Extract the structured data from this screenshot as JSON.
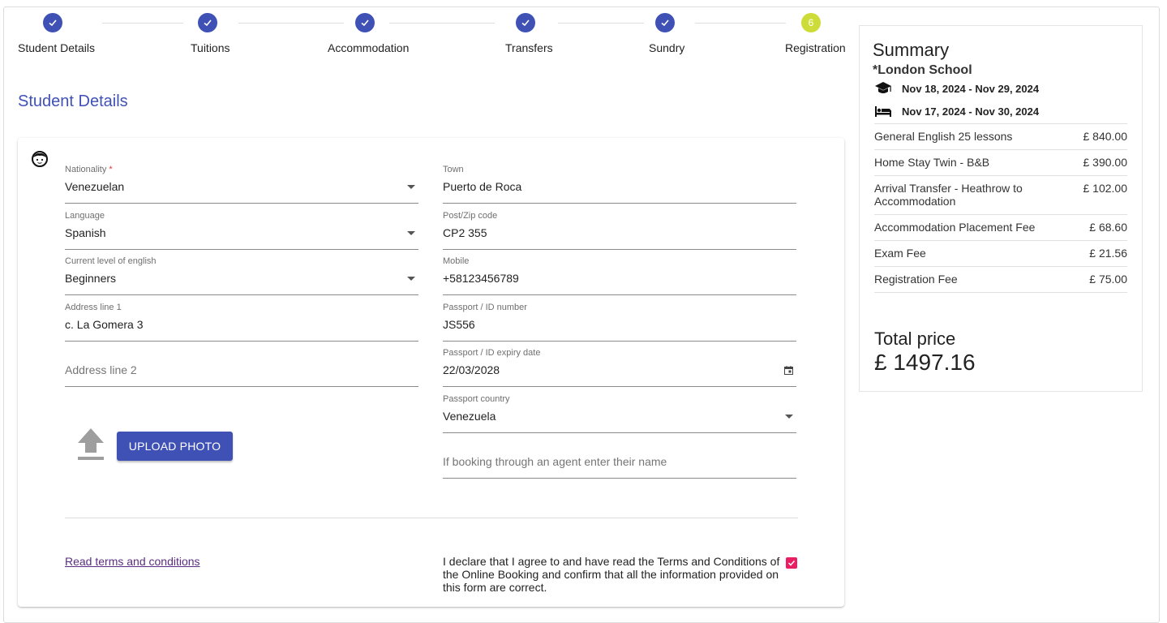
{
  "steps": [
    {
      "label": "Student Details",
      "status": "done"
    },
    {
      "label": "Tuitions",
      "status": "done"
    },
    {
      "label": "Accommodation",
      "status": "done"
    },
    {
      "label": "Transfers",
      "status": "done"
    },
    {
      "label": "Sundry",
      "status": "done"
    },
    {
      "label": "Registration",
      "status": "current",
      "number": "6"
    }
  ],
  "section_title": "Student Details",
  "form": {
    "nationality": {
      "label": "Nationality",
      "required_mark": "*",
      "value": "Venezuelan"
    },
    "language": {
      "label": "Language",
      "value": "Spanish"
    },
    "english_level": {
      "label": "Current level of english",
      "value": "Beginners"
    },
    "address1": {
      "label": "Address line 1",
      "value": "c. La Gomera 3"
    },
    "address2": {
      "placeholder": "Address line 2"
    },
    "town": {
      "label": "Town",
      "value": "Puerto de Roca"
    },
    "postcode": {
      "label": "Post/Zip code",
      "value": "CP2 355"
    },
    "mobile": {
      "label": "Mobile",
      "value": "+58123456789"
    },
    "passport_number": {
      "label": "Passport / ID number",
      "value": "JS556"
    },
    "passport_expiry": {
      "label": "Passport / ID expiry date",
      "value": "22/03/2028"
    },
    "passport_country": {
      "label": "Passport country",
      "value": "Venezuela"
    },
    "agent": {
      "placeholder": "If booking through an agent enter their name"
    },
    "upload_label": "UPLOAD PHOTO",
    "terms_link": "Read terms and conditions",
    "declaration": "I declare that I agree to and have read the Terms and Conditions of the Online Booking and confirm that all the information provided on this form are correct.",
    "declaration_checked": true
  },
  "summary": {
    "title": "Summary",
    "school": "*London School",
    "course_dates": "Nov 18, 2024 - Nov 29, 2024",
    "accommodation_dates": "Nov 17, 2024 - Nov 30, 2024",
    "items": [
      {
        "desc": "General English 25 lessons",
        "price": "£ 840.00"
      },
      {
        "desc": "Home Stay Twin - B&B",
        "price": "£ 390.00"
      },
      {
        "desc": "Arrival Transfer - Heathrow to Accommodation",
        "price": "£ 102.00"
      },
      {
        "desc": "Accommodation Placement Fee",
        "price": "£ 68.60"
      },
      {
        "desc": "Exam Fee",
        "price": "£ 21.56"
      },
      {
        "desc": "Registration Fee",
        "price": "£ 75.00"
      }
    ],
    "total_label": "Total price",
    "total_value": "£ 1497.16"
  },
  "colors": {
    "primary": "#3f51b5",
    "current_step": "#cddc39",
    "checkbox": "#e91e63",
    "link": "#5a2d82"
  },
  "icons": {
    "step_done": "check-icon",
    "student": "face-icon",
    "upload": "upload-icon",
    "course": "graduation-cap-icon",
    "accommodation": "bed-icon",
    "calendar": "calendar-icon"
  }
}
